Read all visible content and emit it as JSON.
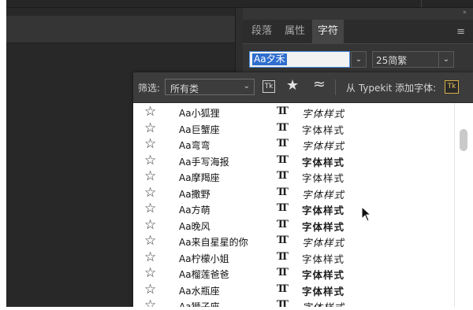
{
  "panel": {
    "collapse_glyph": "››",
    "tabs": [
      "段落",
      "属性",
      "字符"
    ],
    "active_tab": "字符",
    "menu_glyph": "≡",
    "font_family_value": "Aa夕禾",
    "font_style_value": "25简繁"
  },
  "filter": {
    "label": "筛选:",
    "category_value": "所有类",
    "typekit_badge": "Tk",
    "favorites_glyph": "★",
    "similar_glyph": "≈",
    "typekit_label": "从 Typekit 添加字体:",
    "typekit_button": "Tk",
    "dropdown_arrow": "⌄"
  },
  "font_type_glyph": "TT",
  "fonts": [
    {
      "name": "Aa小狐狸",
      "sample": "字体样式",
      "style": "light"
    },
    {
      "name": "Aa巨蟹座",
      "sample": "字体样式",
      "style": "normal"
    },
    {
      "name": "Aa弯弯",
      "sample": "字体样式",
      "style": "light"
    },
    {
      "name": "Aa手写海报",
      "sample": "字体样式",
      "style": "bold"
    },
    {
      "name": "Aa摩羯座",
      "sample": "字体样式",
      "style": "normal"
    },
    {
      "name": "Aa撒野",
      "sample": "字体样式",
      "style": "light"
    },
    {
      "name": "Aa方萌",
      "sample": "字体样式",
      "style": "bold"
    },
    {
      "name": "Aa晚风",
      "sample": "字体样式",
      "style": "bold"
    },
    {
      "name": "Aa来自星星的你",
      "sample": "字体样式",
      "style": "light"
    },
    {
      "name": "Aa柠檬小姐",
      "sample": "字体样式",
      "style": "normal"
    },
    {
      "name": "Aa榴莲爸爸",
      "sample": "字体样式",
      "style": "bold"
    },
    {
      "name": "Aa水瓶座",
      "sample": "字体样式",
      "style": "bold"
    },
    {
      "name": "Aa狮子座",
      "sample": "字体样式",
      "style": "light"
    }
  ],
  "scroll_position": 0.08
}
